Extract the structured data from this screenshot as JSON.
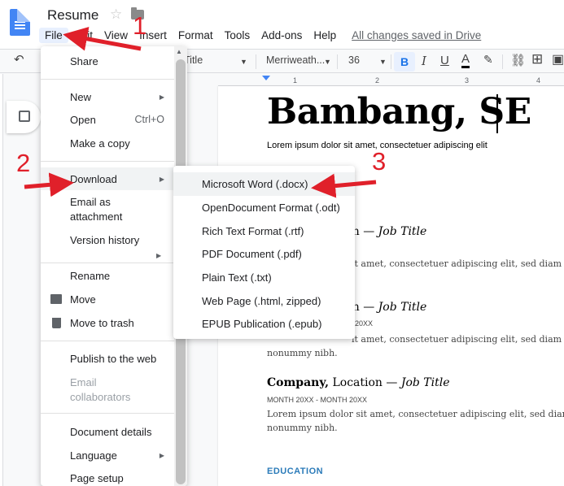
{
  "header": {
    "title": "Resume",
    "menu": [
      "File",
      "Edit",
      "View",
      "Insert",
      "Format",
      "Tools",
      "Add-ons",
      "Help"
    ],
    "save_status": "All changes saved in Drive"
  },
  "toolbar": {
    "style": "Title",
    "font": "Merriweath...",
    "font_size": "36",
    "bold": "B",
    "italic": "I",
    "underline": "U",
    "text_color": "A"
  },
  "ruler": [
    "1",
    "2",
    "3",
    "4"
  ],
  "document": {
    "name": "Bambang, SE",
    "subtitle": "Lorem ipsum dolor sit amet, consectetuer adipiscing elit",
    "frag_location_1": "cation",
    "job_title": "Job Title",
    "dash": " — ",
    "frag_body_1": "it amet, consectetuer adipiscing elit, sed diam",
    "frag_location_2": "cation",
    "frag_date_2": "20XX",
    "frag_body_2": "it amet, consectetuer adipiscing elit, sed diam",
    "frag_body_2b": "nonummy nibh.",
    "company": "Company,",
    "location": " Location",
    "dates": "MONTH 20XX - MONTH 20XX",
    "body_3": "Lorem ipsum dolor sit amet, consectetuer adipiscing elit, sed diam",
    "body_3b": "nonummy nibh.",
    "section_education": "EDUCATION"
  },
  "file_menu": {
    "share": "Share",
    "new": "New",
    "open": "Open",
    "open_shortcut": "Ctrl+O",
    "make_copy": "Make a copy",
    "download": "Download",
    "email_attachment_1": "Email as",
    "email_attachment_2": "attachment",
    "version_history": "Version history",
    "rename": "Rename",
    "move": "Move",
    "move_to_trash": "Move to trash",
    "publish": "Publish to the web",
    "email_collaborators_1": "Email",
    "email_collaborators_2": "collaborators",
    "document_details": "Document details",
    "language": "Language",
    "page_setup": "Page setup"
  },
  "download_submenu": [
    "Microsoft Word (.docx)",
    "OpenDocument Format (.odt)",
    "Rich Text Format (.rtf)",
    "PDF Document (.pdf)",
    "Plain Text (.txt)",
    "Web Page (.html, zipped)",
    "EPUB Publication (.epub)"
  ],
  "annotations": {
    "step1": "1",
    "step2": "2",
    "step3": "3",
    "arrow_color": "#e0202a"
  },
  "colors": {
    "accent": "#1a73e8",
    "doc_blue": "#4285f4",
    "section_heading": "#2b7bb9"
  }
}
